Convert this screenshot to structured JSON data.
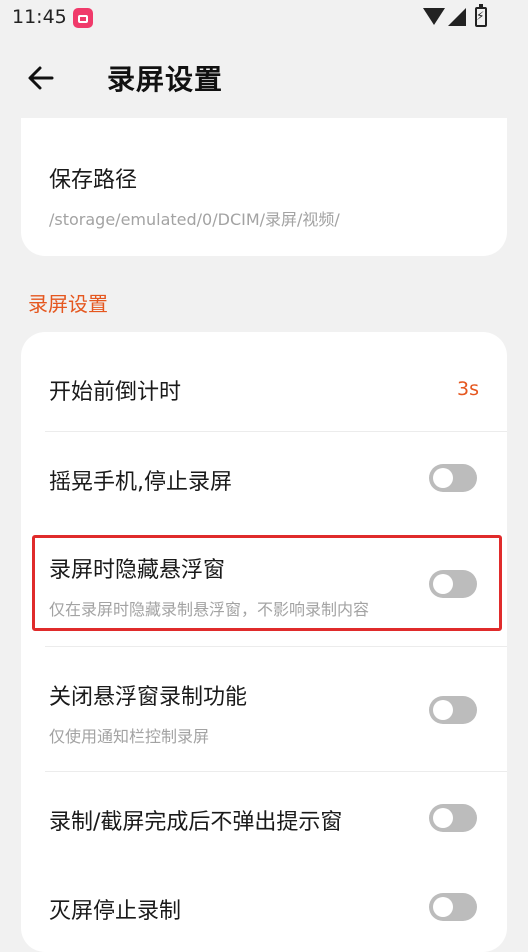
{
  "status_bar": {
    "time": "11:45"
  },
  "header": {
    "title": "录屏设置"
  },
  "save_path": {
    "title": "保存路径",
    "value": "/storage/emulated/0/DCIM/录屏/视频/"
  },
  "section": {
    "title": "录屏设置"
  },
  "settings": {
    "countdown": {
      "title": "开始前倒计时",
      "value": "3s"
    },
    "shake_stop": {
      "title": "摇晃手机,停止录屏",
      "enabled": false
    },
    "hide_float": {
      "title": "录屏时隐藏悬浮窗",
      "subtitle": "仅在录屏时隐藏录制悬浮窗，不影响录制内容",
      "enabled": false
    },
    "close_float": {
      "title": "关闭悬浮窗录制功能",
      "subtitle": "仅使用通知栏控制录屏",
      "enabled": false
    },
    "no_popup": {
      "title": "录制/截屏完成后不弹出提示窗",
      "enabled": false
    },
    "screen_off_stop": {
      "title": "灭屏停止录制",
      "enabled": false
    }
  },
  "colors": {
    "accent": "#e5571f",
    "highlight": "#e02b2b",
    "toggle_off": "#bcbcbc"
  }
}
